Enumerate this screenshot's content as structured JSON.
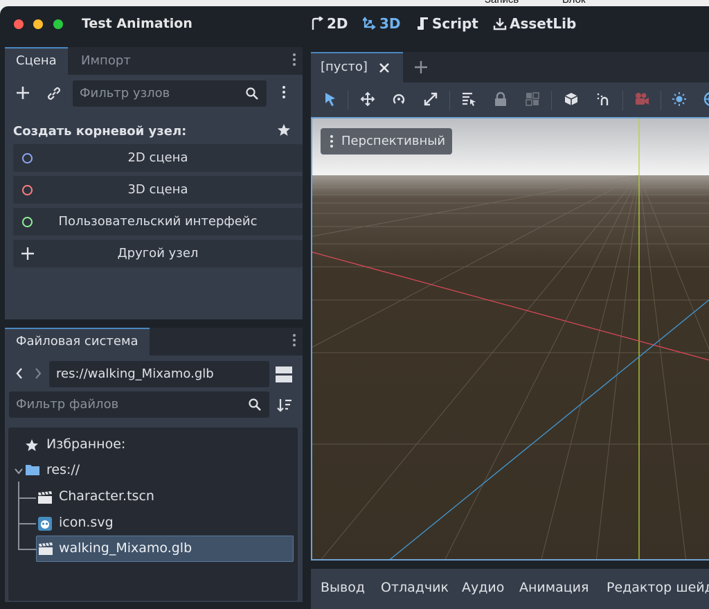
{
  "background_menu": {
    "items": [
      "Запись",
      "Блок"
    ]
  },
  "window": {
    "title": "Test Animation",
    "traffic_lights": {
      "close": "#ff5f57",
      "minimize": "#febc2e",
      "zoom": "#28c840"
    }
  },
  "workspaces": [
    {
      "label": "2D",
      "icon": "2d-arrow-icon"
    },
    {
      "label": "3D",
      "icon": "3d-arrow-icon",
      "active": true
    },
    {
      "label": "Script",
      "icon": "script-icon"
    },
    {
      "label": "AssetLib",
      "icon": "download-icon"
    }
  ],
  "scene_dock": {
    "tabs": [
      "Сцена",
      "Импорт"
    ],
    "filter_placeholder": "Фильтр узлов",
    "create_root_label": "Создать корневой узел:",
    "root_options": [
      {
        "label": "2D сцена",
        "color": "#8da5f3"
      },
      {
        "label": "3D сцена",
        "color": "#fc7f7f"
      },
      {
        "label": "Пользовательский интерфейс",
        "color": "#8eef97"
      },
      {
        "label": "Другой узел",
        "icon": "plus-icon"
      }
    ]
  },
  "filesystem_dock": {
    "tab": "Файловая система",
    "path": "res://walking_Mixamo.glb",
    "filter_placeholder": "Фильтр файлов",
    "favorites_label": "Избранное:",
    "root_label": "res://",
    "files": [
      {
        "name": "Character.tscn",
        "icon": "clapperboard-icon"
      },
      {
        "name": "icon.svg",
        "icon": "godot-icon"
      },
      {
        "name": "walking_Mixamo.glb",
        "icon": "clapperboard-icon",
        "selected": true
      }
    ]
  },
  "editor": {
    "scene_tab": "[пусто]",
    "viewport_mode": "Перспективный",
    "colors": {
      "x_axis": "#e0485a",
      "y_axis": "#b7d13a",
      "z_axis": "#3f9ad6",
      "accent": "#6fb3f0"
    }
  },
  "bottom_panel": [
    "Вывод",
    "Отладчик",
    "Аудио",
    "Анимация",
    "Редактор шейд"
  ]
}
